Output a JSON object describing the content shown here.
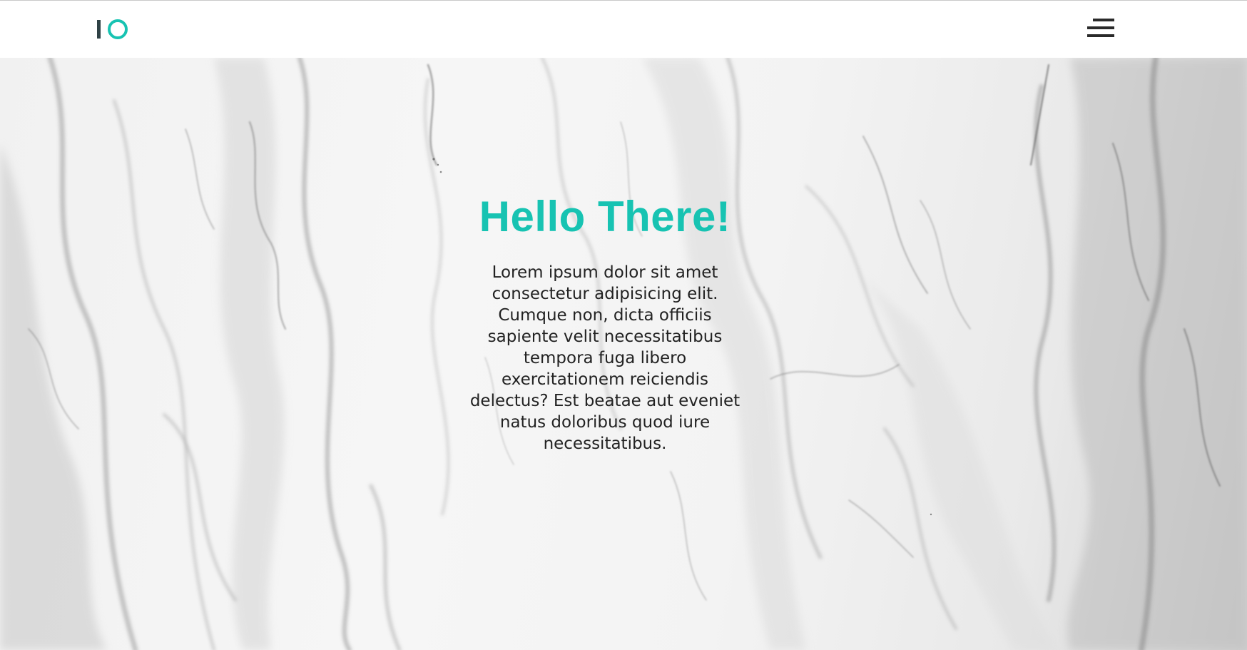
{
  "colors": {
    "accent": "#17c3b2",
    "logo_bar": "#2f4145",
    "text": "#222222",
    "header_bg": "#ffffff",
    "background": "marble-gray"
  },
  "header": {
    "logo_icon": "io-logo-icon",
    "menu_icon": "hamburger-menu-icon"
  },
  "hero": {
    "title": "Hello There!",
    "body": "Lorem ipsum dolor sit amet consectetur adipisicing elit. Cumque non, dicta officiis sapiente velit necessitatibus tempora fuga libero exercitationem reiciendis delectus? Est beatae aut eveniet natus doloribus quod iure necessitatibus."
  }
}
